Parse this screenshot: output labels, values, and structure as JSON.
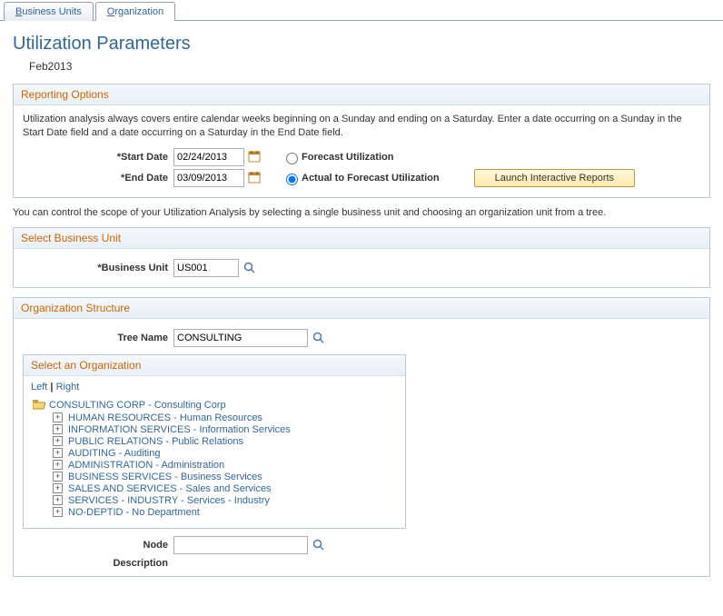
{
  "tabs": {
    "business_units": "Business Units",
    "organization": "Organization"
  },
  "page_title": "Utilization Parameters",
  "subtitle": "Feb2013",
  "reporting": {
    "header": "Reporting Options",
    "info": "Utilization analysis always covers entire calendar weeks beginning on a Sunday and ending on a Saturday. Enter a date occurring on a Sunday in the Start Date field and a date occurring on a Saturday in the End Date field.",
    "start_label": "Start Date",
    "start_value": "02/24/2013",
    "end_label": "End Date",
    "end_value": "03/09/2013",
    "radio1": "Forecast Utilization",
    "radio2": "Actual to Forecast Utilization",
    "launch": "Launch Interactive Reports"
  },
  "scope_text": "You can control the scope of your Utilization Analysis by selecting a single business unit and choosing an organization unit from a tree.",
  "bu": {
    "header": "Select Business Unit",
    "label": "Business Unit",
    "value": "US001"
  },
  "org": {
    "header": "Organization Structure",
    "tree_label": "Tree Name",
    "tree_value": "CONSULTING",
    "select_header": "Select an Organization",
    "left": "Left",
    "right": "Right",
    "root": "CONSULTING CORP - Consulting Corp",
    "nodes": [
      "HUMAN RESOURCES - Human Resources",
      "INFORMATION SERVICES - Information Services",
      "PUBLIC RELATIONS - Public Relations",
      "AUDITING - Auditing",
      "ADMINISTRATION - Administration",
      "BUSINESS SERVICES - Business Services",
      "SALES AND SERVICES - Sales and Services",
      "SERVICES - INDUSTRY - Services - Industry",
      "NO-DEPTID - No Department"
    ],
    "node_label": "Node",
    "node_value": "",
    "desc_label": "Description"
  }
}
